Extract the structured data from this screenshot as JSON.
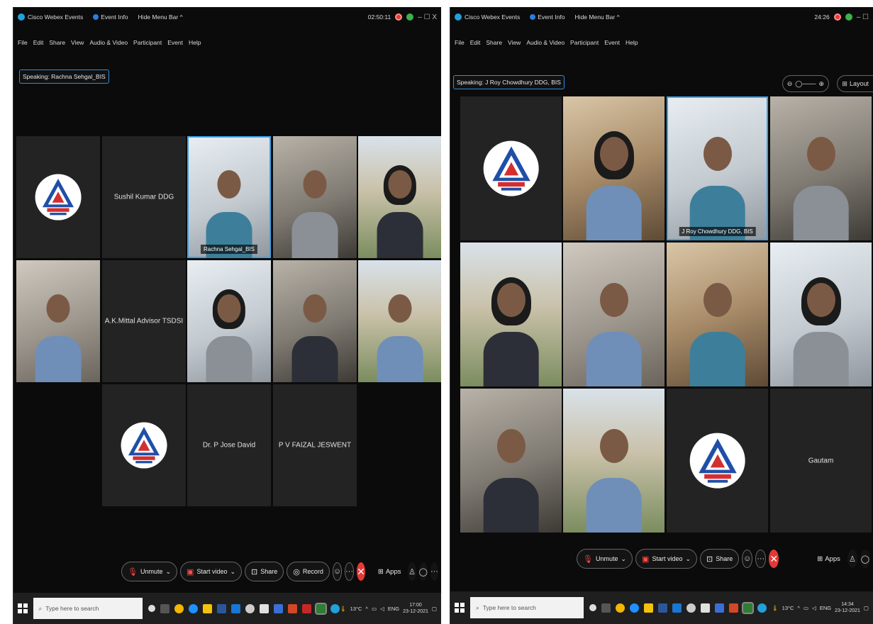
{
  "left_window": {
    "titlebar": {
      "app_name": "Cisco Webex Events",
      "event_info": "Event Info",
      "hide_menu_bar": "Hide Menu Bar ^",
      "timer": "02:50:11",
      "win_controls": "–   ☐   X"
    },
    "menu": [
      "File",
      "Edit",
      "Share",
      "View",
      "Audio & Video",
      "Participant",
      "Event",
      "Help"
    ],
    "speaking": "Speaking: Rachna Sehgal_BIS",
    "tiles": [
      {
        "kind": "logo"
      },
      {
        "kind": "name",
        "name": "Sushil Kumar DDG"
      },
      {
        "kind": "video",
        "label": "Rachna Sehgal_BIS",
        "active": true
      },
      {
        "kind": "video"
      },
      {
        "kind": "video"
      },
      {
        "kind": "video"
      },
      {
        "kind": "name",
        "name": "A.K.Mittal Advisor TSDSI"
      },
      {
        "kind": "video"
      },
      {
        "kind": "video"
      },
      {
        "kind": "video"
      },
      {
        "kind": "logo"
      },
      {
        "kind": "name",
        "name": "Dr. P Jose David"
      },
      {
        "kind": "name",
        "name": "P V FAIZAL JESWENT"
      }
    ],
    "controls": {
      "unmute": "Unmute",
      "start_video": "Start video",
      "share": "Share",
      "record": "Record",
      "apps": "Apps"
    },
    "taskbar": {
      "search_placeholder": "Type here to search",
      "temperature": "13°C",
      "lang": "ENG",
      "time": "17:00",
      "date": "23-12-2021"
    }
  },
  "right_window": {
    "titlebar": {
      "app_name": "Cisco Webex Events",
      "event_info": "Event Info",
      "hide_menu_bar": "Hide Menu Bar ^",
      "timer": "24:26",
      "win_controls": "–   ☐"
    },
    "menu": [
      "File",
      "Edit",
      "Share",
      "View",
      "Audio & Video",
      "Participant",
      "Event",
      "Help"
    ],
    "speaking": "Speaking: J Roy Chowdhury DDG, BIS",
    "layout_label": "Layout",
    "tiles": [
      {
        "kind": "logo"
      },
      {
        "kind": "video"
      },
      {
        "kind": "video",
        "label": "J Roy Chowdhury DDG, BIS",
        "active": true
      },
      {
        "kind": "video"
      },
      {
        "kind": "video"
      },
      {
        "kind": "video"
      },
      {
        "kind": "video"
      },
      {
        "kind": "video"
      },
      {
        "kind": "video"
      },
      {
        "kind": "video"
      },
      {
        "kind": "logo"
      },
      {
        "kind": "name",
        "name": "Gautam"
      }
    ],
    "controls": {
      "unmute": "Unmute",
      "start_video": "Start video",
      "share": "Share",
      "apps": "Apps"
    },
    "taskbar": {
      "search_placeholder": "Type here to search",
      "temperature": "13°C",
      "lang": "ENG",
      "time": "14:34",
      "date": "23-12-2021"
    }
  },
  "colors": {
    "background": "#0b0b0b",
    "tile": "#232323",
    "active_border": "#3ea2e6",
    "end_button": "#e53935",
    "logo_blue": "#1f4fa8",
    "logo_red": "#d32f2f"
  }
}
